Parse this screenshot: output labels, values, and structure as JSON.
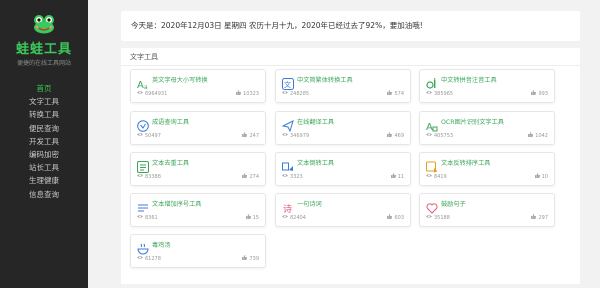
{
  "site": {
    "title": "蛙蛙工具",
    "subtitle": "便捷的在线工具网站"
  },
  "nav": [
    {
      "label": "首页"
    },
    {
      "label": "文字工具"
    },
    {
      "label": "转换工具"
    },
    {
      "label": "便民查询"
    },
    {
      "label": "开发工具"
    },
    {
      "label": "编码加密"
    },
    {
      "label": "站长工具"
    },
    {
      "label": "生理健康"
    },
    {
      "label": "信息查询"
    }
  ],
  "banner": {
    "text": "今天是：2020年12月03日 星期四 农历十月十九，2020年已经过去了92%，要加油哦!"
  },
  "section": {
    "title": "文字工具"
  },
  "tools": [
    {
      "title": "英文字母大小写转换",
      "views": "6964931",
      "likes": "10323",
      "icon": "font-case-icon",
      "color": "#3da55a"
    },
    {
      "title": "中文简繁体转换工具",
      "views": "248285",
      "likes": "574",
      "icon": "chinese-convert-icon",
      "color": "#3d7bd8"
    },
    {
      "title": "中文转拼音注音工具",
      "views": "385965",
      "likes": "993",
      "icon": "pinyin-icon",
      "color": "#3da55a"
    },
    {
      "title": "成语查询工具",
      "views": "50497",
      "likes": "247",
      "icon": "idiom-icon",
      "color": "#3d7bd8"
    },
    {
      "title": "在线翻译工具",
      "views": "346979",
      "likes": "469",
      "icon": "translate-icon",
      "color": "#3d7bd8"
    },
    {
      "title": "OCR图片识别文字工具",
      "views": "405753",
      "likes": "1042",
      "icon": "ocr-icon",
      "color": "#3da55a"
    },
    {
      "title": "文本去重工具",
      "views": "83388",
      "likes": "274",
      "icon": "dedupe-icon",
      "color": "#3da55a"
    },
    {
      "title": "文本倒转工具",
      "views": "3323",
      "likes": "11",
      "icon": "reverse-icon",
      "color": "#3d7bd8"
    },
    {
      "title": "文本反转排序工具",
      "views": "8419",
      "likes": "10",
      "icon": "sort-icon",
      "color": "#e0a020"
    },
    {
      "title": "文本增加序号工具",
      "views": "8361",
      "likes": "15",
      "icon": "numbering-icon",
      "color": "#3d7bd8"
    },
    {
      "title": "一句诗词",
      "views": "82404",
      "likes": "603",
      "icon": "poem-icon",
      "color": "#e06070"
    },
    {
      "title": "鼓励句子",
      "views": "35188",
      "likes": "297",
      "icon": "heart-icon",
      "color": "#e06070"
    },
    {
      "title": "毒鸡汤",
      "views": "61278",
      "likes": "739",
      "icon": "soup-icon",
      "color": "#3d7bd8"
    }
  ]
}
